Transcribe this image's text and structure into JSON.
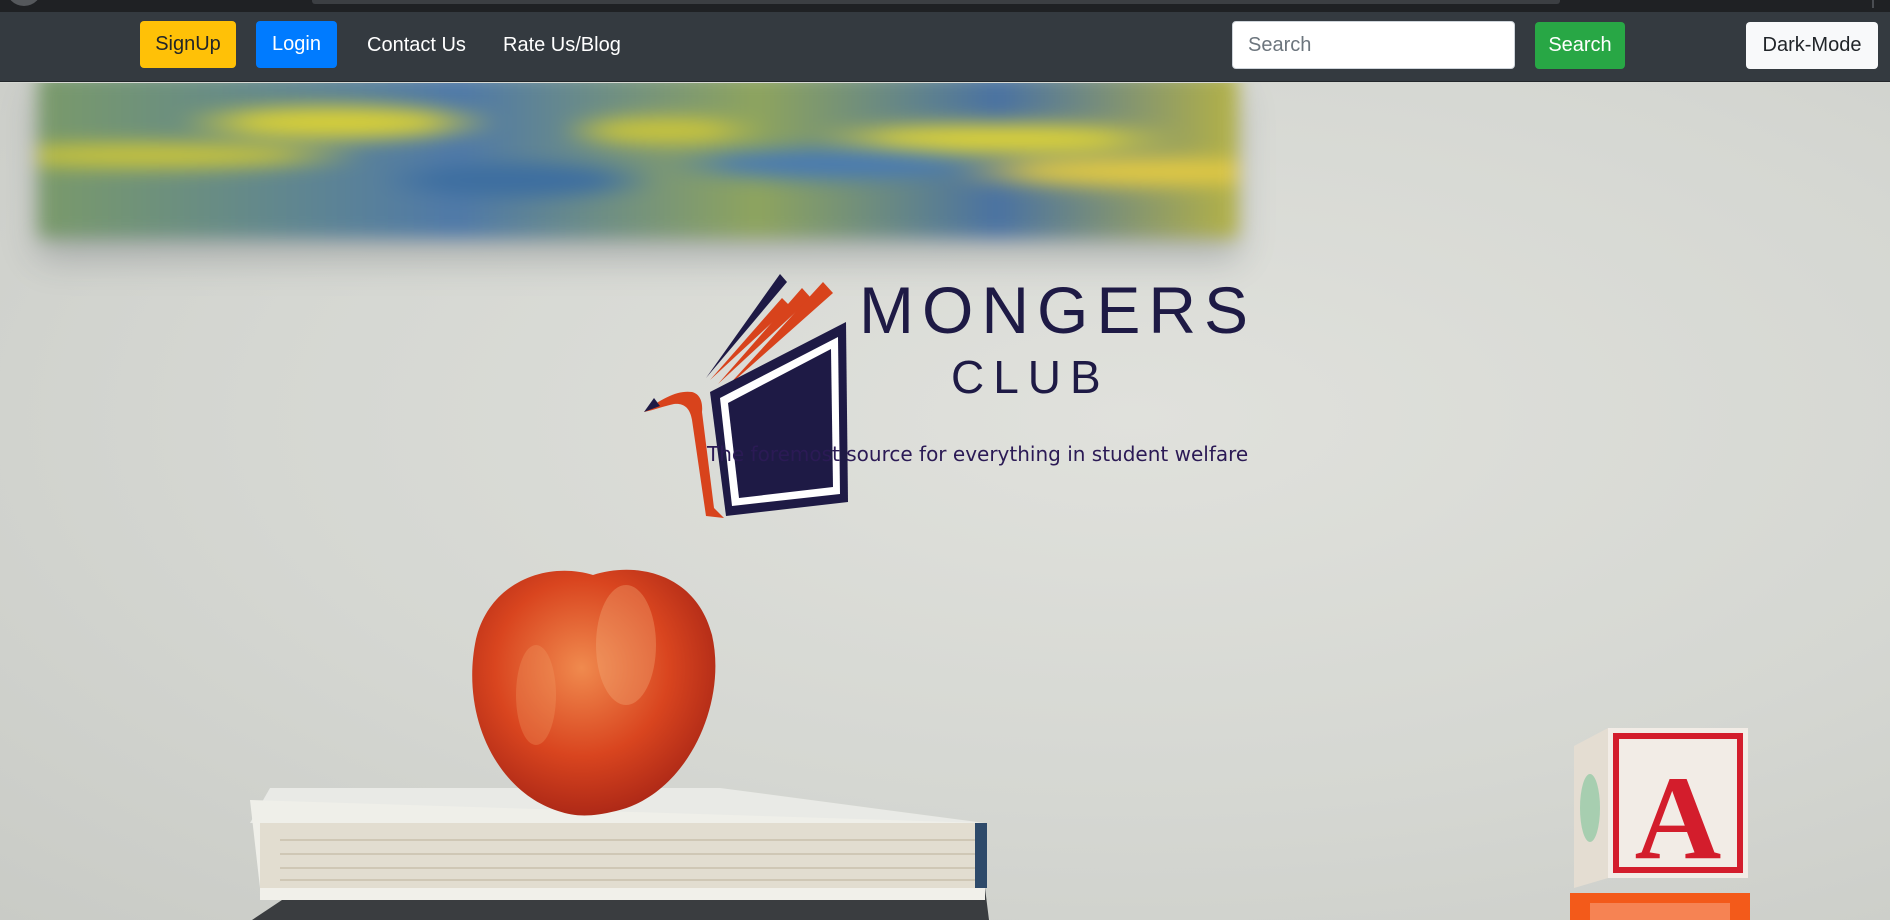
{
  "navbar": {
    "signup_label": "SignUp",
    "login_label": "Login",
    "contact_label": "Contact Us",
    "rate_label": "Rate Us/Blog",
    "search_placeholder": "Search",
    "search_button_label": "Search",
    "dark_mode_label": "Dark-Mode"
  },
  "hero": {
    "logo_title": "MONGERS",
    "logo_subtitle": "CLUB",
    "tagline": "The foremost source for everything in student welfare"
  },
  "colors": {
    "navbar_bg": "#343a40",
    "signup": "#ffc107",
    "login": "#007bff",
    "search_button": "#28a745",
    "logo_navy": "#1e1a45",
    "logo_orange": "#d8431c"
  }
}
